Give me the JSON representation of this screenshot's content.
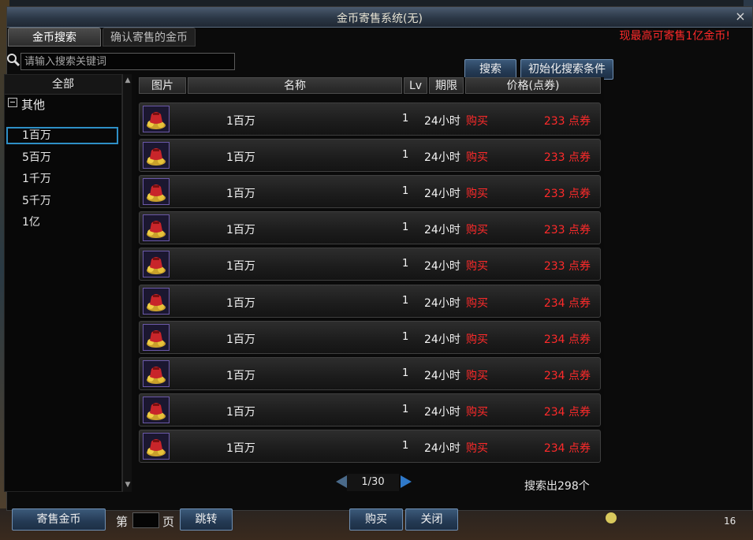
{
  "window": {
    "title": "金币寄售系统(无)",
    "close_label": "×"
  },
  "tabs": [
    {
      "label": "金币搜索",
      "active": true
    },
    {
      "label": "确认寄售的金币",
      "active": false
    }
  ],
  "notice": "现最高可寄售1亿金币!",
  "search": {
    "placeholder": "请输入搜索关键词",
    "search_button": "搜索",
    "reset_button": "初始化搜索条件"
  },
  "tree": {
    "header": "全部",
    "group_label": "其他",
    "items": [
      {
        "label": "1百万",
        "selected": true
      },
      {
        "label": "5百万",
        "selected": false
      },
      {
        "label": "1千万",
        "selected": false
      },
      {
        "label": "5千万",
        "selected": false
      },
      {
        "label": "1亿",
        "selected": false
      }
    ]
  },
  "columns": {
    "image": "图片",
    "name": "名称",
    "lv": "Lv",
    "period": "期限",
    "price": "价格(点券)"
  },
  "rows": [
    {
      "name": "1百万",
      "lv": "1",
      "period": "24小时",
      "buy": "购买",
      "price": "233 点券"
    },
    {
      "name": "1百万",
      "lv": "1",
      "period": "24小时",
      "buy": "购买",
      "price": "233 点券"
    },
    {
      "name": "1百万",
      "lv": "1",
      "period": "24小时",
      "buy": "购买",
      "price": "233 点券"
    },
    {
      "name": "1百万",
      "lv": "1",
      "period": "24小时",
      "buy": "购买",
      "price": "233 点券"
    },
    {
      "name": "1百万",
      "lv": "1",
      "period": "24小时",
      "buy": "购买",
      "price": "233 点券"
    },
    {
      "name": "1百万",
      "lv": "1",
      "period": "24小时",
      "buy": "购买",
      "price": "234 点券"
    },
    {
      "name": "1百万",
      "lv": "1",
      "period": "24小时",
      "buy": "购买",
      "price": "234 点券"
    },
    {
      "name": "1百万",
      "lv": "1",
      "period": "24小时",
      "buy": "购买",
      "price": "234 点券"
    },
    {
      "name": "1百万",
      "lv": "1",
      "period": "24小时",
      "buy": "购买",
      "price": "234 点券"
    },
    {
      "name": "1百万",
      "lv": "1",
      "period": "24小时",
      "buy": "购买",
      "price": "234 点券"
    }
  ],
  "pager": {
    "text": "1/30",
    "result_count": "搜索出298个"
  },
  "bottom": {
    "sell_button": "寄售金币",
    "page_prefix": "第",
    "page_suffix": "页",
    "jump_button": "跳转",
    "buy_button": "购买",
    "close_button": "关闭"
  },
  "hud": {
    "number": "16"
  }
}
